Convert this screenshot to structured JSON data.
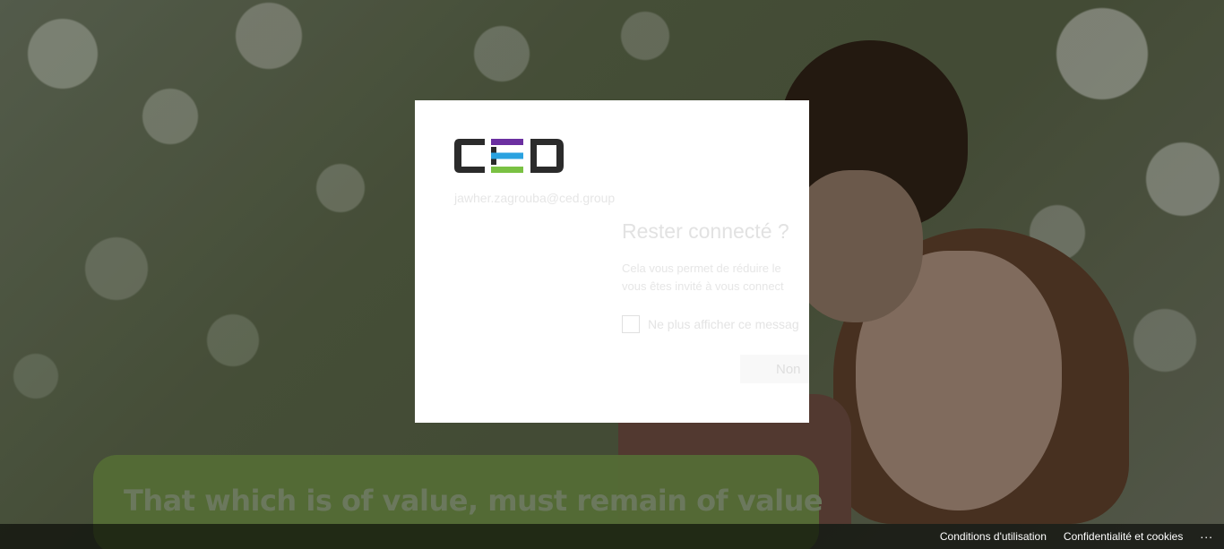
{
  "banner": {
    "text": "That which is of value, must remain of value"
  },
  "dialog": {
    "logo_text": "CED",
    "identity": "jawher.zagrouba@ced.group",
    "title": "Rester connecté ?",
    "description_line1": "Cela vous permet de réduire le",
    "description_line2": "vous êtes invité à vous connect",
    "checkbox_label": "Ne plus afficher ce messag",
    "checkbox_checked": false,
    "no_button": "Non"
  },
  "footer": {
    "terms": "Conditions d'utilisation",
    "privacy": "Confidentialité et cookies",
    "more": "..."
  },
  "colors": {
    "logo_dark": "#2b2b2b",
    "logo_purple": "#6b2fa0",
    "logo_blue": "#2aa2e0",
    "logo_green": "#7ac143",
    "banner_green": "#6d8a45"
  }
}
